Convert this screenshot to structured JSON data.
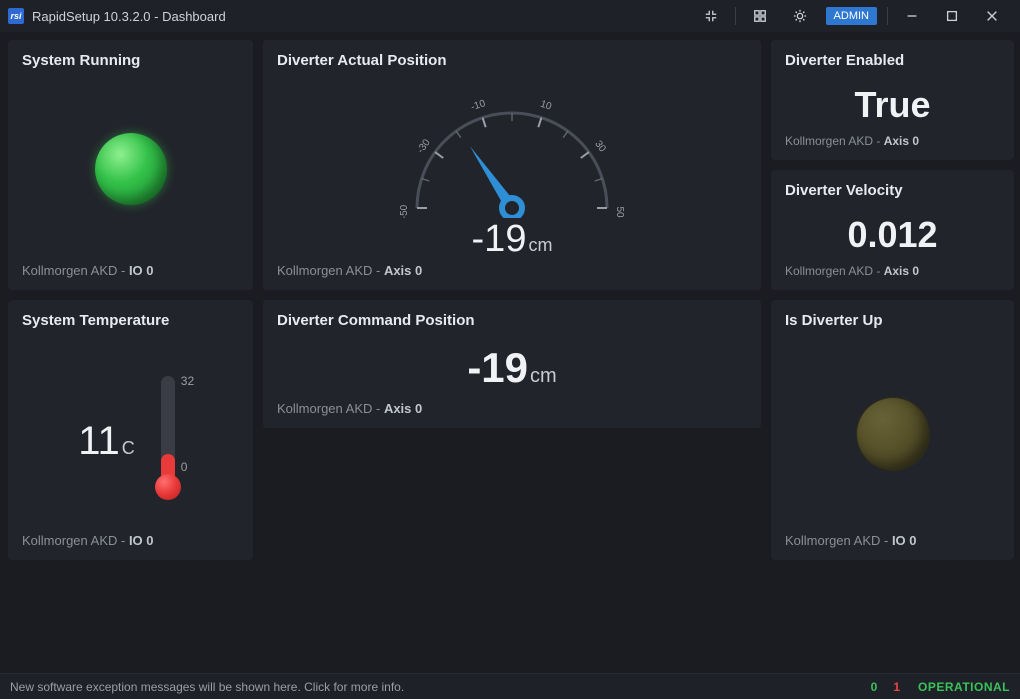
{
  "window": {
    "logo_text": "rsi",
    "title": "RapidSetup 10.3.2.0 - Dashboard",
    "admin_badge": "ADMIN"
  },
  "cards": {
    "system_running": {
      "title": "System Running",
      "led_on": true,
      "footer_prefix": "Kollmorgen AKD - ",
      "footer_strong": "IO 0"
    },
    "diverter_actual": {
      "title": "Diverter Actual Position",
      "value": "-19",
      "unit": "cm",
      "gauge_ticks": [
        "-50",
        "-30",
        "-10",
        "10",
        "30",
        "50"
      ],
      "gauge_min": -50,
      "gauge_max": 50,
      "footer_prefix": "Kollmorgen AKD - ",
      "footer_strong": "Axis 0"
    },
    "diverter_enabled": {
      "title": "Diverter Enabled",
      "value": "True",
      "footer_prefix": "Kollmorgen AKD - ",
      "footer_strong": "Axis 0"
    },
    "diverter_velocity": {
      "title": "Diverter Velocity",
      "value": "0.012",
      "footer_prefix": "Kollmorgen AKD - ",
      "footer_strong": "Axis 0"
    },
    "system_temp": {
      "title": "System Temperature",
      "value": "11",
      "unit": "C",
      "scale_hi": "32",
      "scale_lo": "0",
      "footer_prefix": "Kollmorgen AKD - ",
      "footer_strong": "IO 0"
    },
    "diverter_cmd": {
      "title": "Diverter Command Position",
      "value": "-19",
      "unit": "cm",
      "footer_prefix": "Kollmorgen AKD - ",
      "footer_strong": "Axis 0"
    },
    "is_diverter_up": {
      "title": "Is Diverter Up",
      "led_on": false,
      "footer_prefix": "Kollmorgen AKD - ",
      "footer_strong": "IO 0"
    }
  },
  "statusbar": {
    "message": "New software exception messages will be shown here. Click for more info.",
    "count_ok": "0",
    "count_err": "1",
    "state": "OPERATIONAL"
  },
  "chart_data": {
    "type": "gauge",
    "title": "Diverter Actual Position",
    "min": -50,
    "max": 50,
    "value": -19,
    "unit": "cm",
    "ticks": [
      -50,
      -30,
      -10,
      10,
      30,
      50
    ]
  }
}
